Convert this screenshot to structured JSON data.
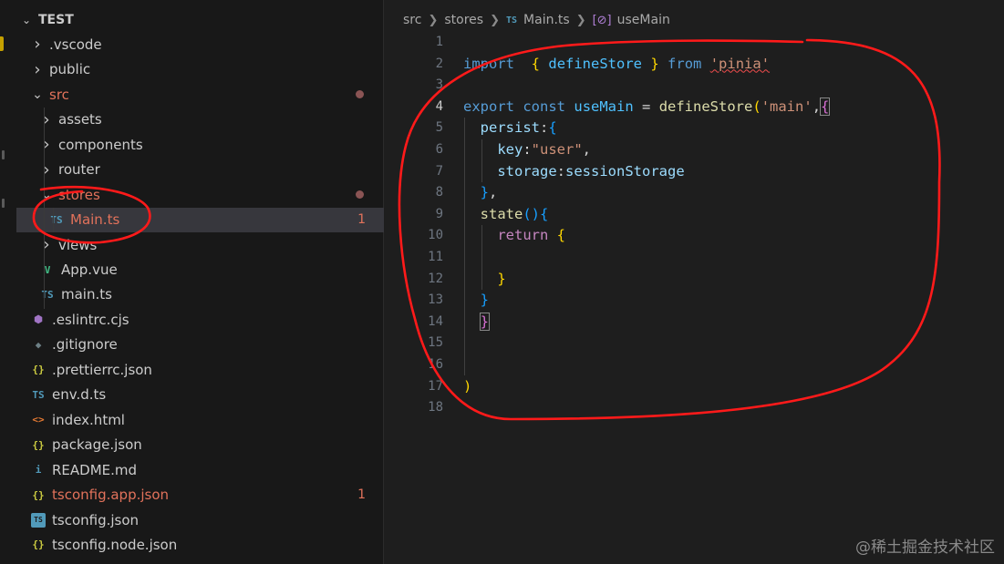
{
  "explorer": {
    "root_label": "TEST",
    "items": [
      {
        "name": ".vscode",
        "type": "folder",
        "depth": 1,
        "open": false
      },
      {
        "name": "public",
        "type": "folder",
        "depth": 1,
        "open": false
      },
      {
        "name": "src",
        "type": "folder",
        "depth": 1,
        "open": true,
        "modified": true
      },
      {
        "name": "assets",
        "type": "folder",
        "depth": 2,
        "open": false
      },
      {
        "name": "components",
        "type": "folder",
        "depth": 2,
        "open": false
      },
      {
        "name": "router",
        "type": "folder",
        "depth": 2,
        "open": false
      },
      {
        "name": "stores",
        "type": "folder",
        "depth": 2,
        "open": true,
        "modified": true
      },
      {
        "name": "Main.ts",
        "type": "ts",
        "depth": 3,
        "modified": true,
        "badge": "1",
        "selected": true
      },
      {
        "name": "views",
        "type": "folder",
        "depth": 2,
        "open": false
      },
      {
        "name": "App.vue",
        "type": "vue",
        "depth": 2
      },
      {
        "name": "main.ts",
        "type": "ts",
        "depth": 2
      },
      {
        "name": ".eslintrc.cjs",
        "type": "eslint",
        "depth": 1
      },
      {
        "name": ".gitignore",
        "type": "git",
        "depth": 1
      },
      {
        "name": ".prettierrc.json",
        "type": "json",
        "depth": 1
      },
      {
        "name": "env.d.ts",
        "type": "ts",
        "depth": 1
      },
      {
        "name": "index.html",
        "type": "html",
        "depth": 1
      },
      {
        "name": "package.json",
        "type": "json",
        "depth": 1
      },
      {
        "name": "README.md",
        "type": "info",
        "depth": 1
      },
      {
        "name": "tsconfig.app.json",
        "type": "json",
        "depth": 1,
        "modified": true,
        "badge": "1"
      },
      {
        "name": "tsconfig.json",
        "type": "tsconfig",
        "depth": 1
      },
      {
        "name": "tsconfig.node.json",
        "type": "json",
        "depth": 1
      }
    ]
  },
  "icons": {
    "chevron_right": "chevron-right-icon",
    "chevron_down": "chevron-down-icon",
    "ts_glyph": "TS",
    "json_glyph": "{}",
    "html_glyph": "<>",
    "vue_glyph": "V",
    "info_glyph": "i",
    "git_glyph": "◆",
    "eslint_glyph": "⬢"
  },
  "breadcrumb": {
    "folder1": "src",
    "folder2": "stores",
    "file_icon": "TS",
    "file": "Main.ts",
    "symbol_icon": "[⊘]",
    "symbol": "useMain"
  },
  "editor": {
    "active_line": 4,
    "line_numbers": [
      "1",
      "2",
      "3",
      "4",
      "5",
      "6",
      "7",
      "8",
      "9",
      "10",
      "11",
      "12",
      "13",
      "14",
      "15",
      "16",
      "17",
      "18"
    ],
    "lines": [
      [],
      [
        [
          "kw",
          "import"
        ],
        [
          "",
          "  "
        ],
        [
          "br1",
          "{"
        ],
        [
          "",
          " "
        ],
        [
          "var",
          "defineStore"
        ],
        [
          "",
          " "
        ],
        [
          "br1",
          "}"
        ],
        [
          "",
          " "
        ],
        [
          "kw",
          "from"
        ],
        [
          "",
          " "
        ],
        [
          "str squig",
          "'pinia'"
        ]
      ],
      [],
      [
        [
          "kw",
          "export"
        ],
        [
          "",
          " "
        ],
        [
          "kw",
          "const"
        ],
        [
          "",
          " "
        ],
        [
          "var",
          "useMain"
        ],
        [
          "",
          " = "
        ],
        [
          "fn",
          "defineStore"
        ],
        [
          "br1",
          "("
        ],
        [
          "str",
          "'main'"
        ],
        [
          "",
          ","
        ],
        [
          "br2 bracket-box",
          "{"
        ]
      ],
      [
        [
          "",
          "  "
        ],
        [
          "prop",
          "persist"
        ],
        [
          "",
          ":"
        ],
        [
          "br3",
          "{"
        ]
      ],
      [
        [
          "",
          "    "
        ],
        [
          "prop",
          "key"
        ],
        [
          "",
          ":"
        ],
        [
          "str",
          "\"user\""
        ],
        [
          "",
          ","
        ]
      ],
      [
        [
          "",
          "    "
        ],
        [
          "prop",
          "storage"
        ],
        [
          "",
          ":"
        ],
        [
          "prop",
          "sessionStorage"
        ]
      ],
      [
        [
          "",
          "  "
        ],
        [
          "br3",
          "}"
        ],
        [
          "",
          ","
        ]
      ],
      [
        [
          "",
          "  "
        ],
        [
          "fn",
          "state"
        ],
        [
          "br3",
          "()"
        ],
        [
          "br3",
          "{"
        ]
      ],
      [
        [
          "",
          "    "
        ],
        [
          "ctl",
          "return"
        ],
        [
          "",
          " "
        ],
        [
          "br1",
          "{"
        ]
      ],
      [],
      [
        [
          "",
          "    "
        ],
        [
          "br1",
          "}"
        ]
      ],
      [
        [
          "",
          "  "
        ],
        [
          "br3",
          "}"
        ]
      ],
      [
        [
          "",
          "  "
        ],
        [
          "br2 bracket-box",
          "}"
        ]
      ],
      [],
      [],
      [
        [
          "br1",
          ")"
        ]
      ],
      []
    ]
  },
  "watermark": "@稀土掘金技术社区",
  "colors": {
    "sidebar_bg": "#181818",
    "editor_bg": "#1e1e1e",
    "selected_row": "#37373d",
    "modified": "#e2725b",
    "ts_icon": "#519aba",
    "json_icon": "#cbcb41",
    "annotation_red": "#ff1a1a"
  }
}
